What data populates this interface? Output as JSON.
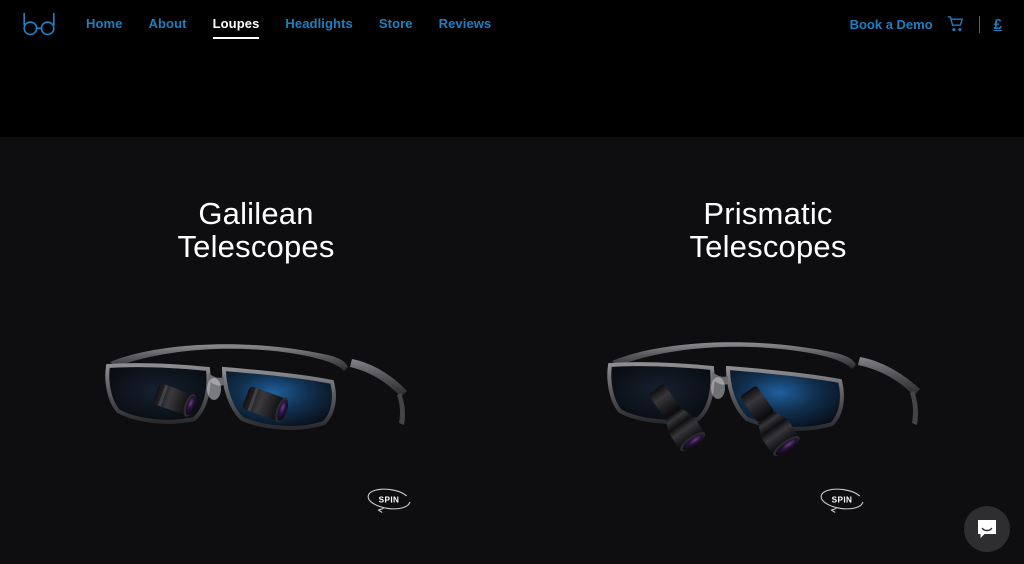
{
  "site": {
    "logo_label": "bd",
    "background_color": "#0e0e10",
    "header_color": "#000000",
    "accent_color": "#1e7fc2",
    "text_color": "#ffffff"
  },
  "nav": {
    "links": [
      {
        "label": "Home",
        "active": false
      },
      {
        "label": "About",
        "active": false
      },
      {
        "label": "Loupes",
        "active": true
      },
      {
        "label": "Headlights",
        "active": false
      },
      {
        "label": "Store",
        "active": false
      },
      {
        "label": "Reviews",
        "active": false
      }
    ],
    "book_demo_label": "Book a Demo",
    "cart_icon": "shopping-cart-icon",
    "currency_label": "£"
  },
  "products": [
    {
      "title_line1": "Galilean",
      "title_line2": "Telescopes",
      "image_alt": "galilean-loupes-product-image",
      "spin_label": "SPIN"
    },
    {
      "title_line1": "Prismatic",
      "title_line2": "Telescopes",
      "image_alt": "prismatic-loupes-product-image",
      "spin_label": "SPIN"
    }
  ],
  "chat": {
    "icon": "chat-bubble-icon",
    "label": "Open chat"
  }
}
